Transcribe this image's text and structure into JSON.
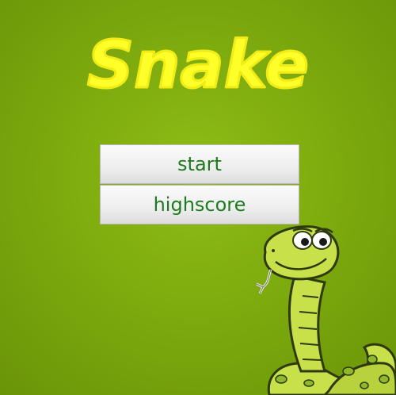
{
  "game": {
    "title": "Snake"
  },
  "menu": {
    "start_label": "start",
    "highscore_label": "highscore"
  },
  "colors": {
    "background": "#7eab0e",
    "title": "#ffff2a",
    "button_text": "#1e7a1e",
    "snake_body": "#c8e04a",
    "snake_spots": "#8fb82a"
  },
  "icons": {
    "mascot": "snake-mascot-icon"
  }
}
